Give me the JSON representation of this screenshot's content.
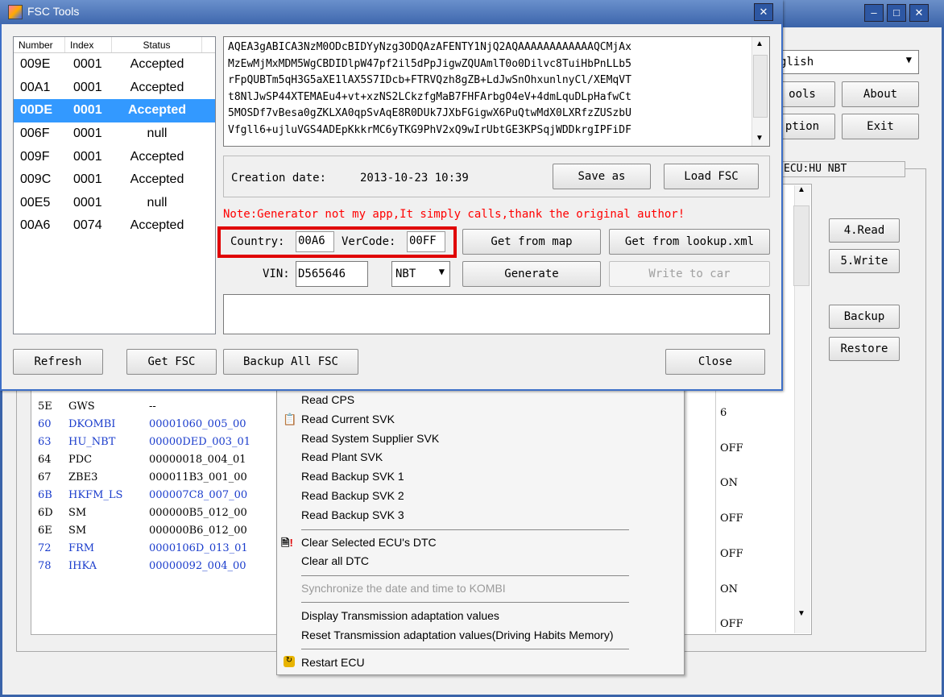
{
  "bg_window": {
    "right_dropdown": "glish",
    "tools_btn": "ools",
    "about_btn": "About",
    "option_btn": "ption",
    "exit_btn": "Exit",
    "group_label": "ECU:HU NBT",
    "read_btn": "4.Read",
    "write_btn": "5.Write",
    "backup_btn": "Backup",
    "restore_btn": "Restore",
    "restore_u": "R",
    "restore_rest": "estore"
  },
  "ecu_rows": [
    {
      "addr": "5E",
      "name": "GWS",
      "svk": "--",
      "blue": false
    },
    {
      "addr": "60",
      "name": "DKOMBI",
      "svk": "00001060_005_00",
      "blue": true
    },
    {
      "addr": "63",
      "name": "HU_NBT",
      "svk": "00000DED_003_01",
      "blue": true
    },
    {
      "addr": "64",
      "name": "PDC",
      "svk": "00000018_004_01",
      "blue": false
    },
    {
      "addr": "67",
      "name": "ZBE3",
      "svk": "000011B3_001_00",
      "blue": false
    },
    {
      "addr": "6B",
      "name": "HKFM_LS",
      "svk": "000007C8_007_00",
      "blue": true
    },
    {
      "addr": "6D",
      "name": "SM",
      "svk": "000000B5_012_00",
      "blue": false
    },
    {
      "addr": "6E",
      "name": "SM",
      "svk": "000000B6_012_00",
      "blue": false
    },
    {
      "addr": "72",
      "name": "FRM",
      "svk": "0000106D_013_01",
      "blue": true
    },
    {
      "addr": "78",
      "name": "IHKA",
      "svk": "00000092_004_00",
      "blue": true
    }
  ],
  "right_values": [
    "6",
    "OFF",
    "ON",
    "OFF",
    "OFF",
    "ON",
    "OFF"
  ],
  "menu": {
    "items": [
      "Read CPS",
      "Read Current SVK",
      "Read System Supplier SVK",
      "Read Plant SVK",
      "Read Backup SVK 1",
      "Read Backup SVK 2",
      "Read Backup SVK 3",
      "Clear Selected ECU's DTC",
      "Clear all DTC",
      "Synchronize the date and time to KOMBI",
      "Display Transmission adaptation values",
      "Reset Transmission adaptation values(Driving Habits Memory)",
      "Restart ECU"
    ]
  },
  "fsc": {
    "title": "FSC Tools",
    "list_headers": [
      "Number",
      "Index",
      "Status"
    ],
    "rows": [
      {
        "number": "009E",
        "index": "0001",
        "status": "Accepted"
      },
      {
        "number": "00A1",
        "index": "0001",
        "status": "Accepted"
      },
      {
        "number": "00DE",
        "index": "0001",
        "status": "Accepted",
        "selected": true
      },
      {
        "number": "006F",
        "index": "0001",
        "status": "null"
      },
      {
        "number": "009F",
        "index": "0001",
        "status": "Accepted"
      },
      {
        "number": "009C",
        "index": "0001",
        "status": "Accepted"
      },
      {
        "number": "00E5",
        "index": "0001",
        "status": "null"
      },
      {
        "number": "00A6",
        "index": "0074",
        "status": "Accepted"
      }
    ],
    "code_lines": [
      "AQEA3gABICA3NzM0ODcBIDYyNzg3ODQAzAFENTY1NjQ2AQAAAAAAAAAAAAQCMjAx",
      "MzEwMjMxMDM5WgCBDIDlpW47pf2il5dPpJigwZQUAmlT0o0Dilvc8TuiHbPnLLb5",
      "rFpQUBTm5qH3G5aXE1lAX5S7IDcb+FTRVQzh8gZB+LdJwSnOhxunlnyCl/XEMqVT",
      "t8NlJwSP44XTEMAEu4+vt+xzNS2LCkzfgMaB7FHFArbgO4eV+4dmLquDLpHafwCt",
      "5MOSDf7vBesa0gZKLXA0qpSvAqE8R0DUk7JXbFGigwX6PuQtwMdX0LXRfzZUSzbU",
      "Vfgll6+ujluVGS4ADEpKkkrMC6yTKG9PhV2xQ9wIrUbtGE3KPSqjWDDkrgIPFiDF"
    ],
    "creation_label": "Creation date:",
    "creation_value": "2013-10-23 10:39",
    "save_as": "Save as",
    "load_fsc": "Load FSC",
    "note": "Note:Generator not my app,It simply calls,thank the original author!",
    "country_label": "Country:",
    "country_value": "00A6",
    "vercode_label": "VerCode:",
    "vercode_value": "00FF",
    "get_from_map": "Get from map",
    "get_from_lookup": "Get from lookup.xml",
    "vin_label": "VIN:",
    "vin_value": "D565646",
    "model": "NBT",
    "generate": "Generate",
    "write_to_car": "Write to car",
    "refresh": "Refresh",
    "get_fsc": "Get FSC",
    "backup_all": "Backup All FSC",
    "close": "Close"
  },
  "colors": {
    "accent": "#3399ff",
    "note_red": "#ff0000",
    "highlight_box": "#e00000",
    "titlebar": "#5f86c2",
    "link_blue": "#1a3ccc"
  }
}
